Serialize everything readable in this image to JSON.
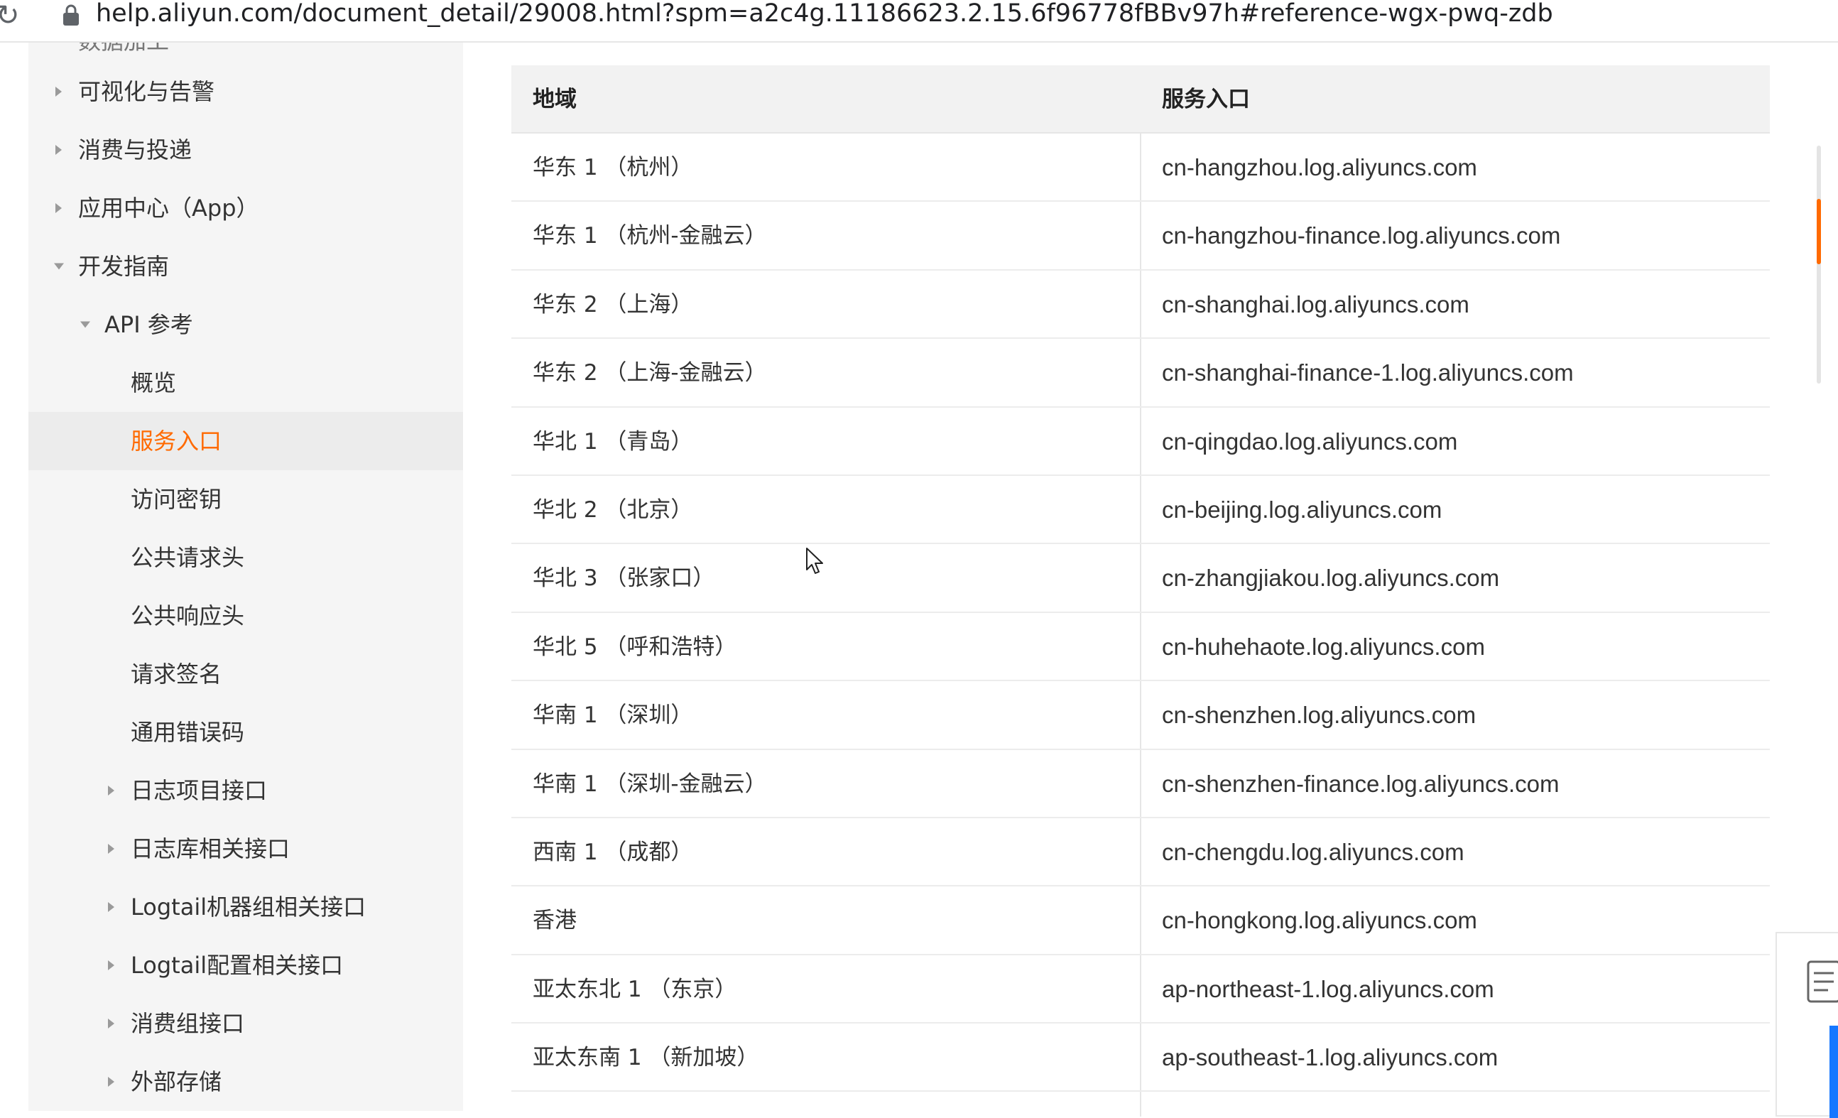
{
  "browser": {
    "url": "help.aliyun.com/document_detail/29008.html?spm=a2c4g.11186623.2.15.6f96778fBBv97h#reference-wgx-pwq-zdb"
  },
  "sidebar": {
    "cut_item": "数据加工",
    "items": [
      {
        "label": "可视化与告警",
        "arrow": "right"
      },
      {
        "label": "消费与投递",
        "arrow": "right"
      },
      {
        "label": "应用中心（App）",
        "arrow": "right"
      },
      {
        "label": "开发指南",
        "arrow": "down"
      },
      {
        "label": "API 参考",
        "arrow": "down"
      },
      {
        "label": "概览",
        "arrow": "none"
      },
      {
        "label": "服务入口",
        "arrow": "none",
        "active": true
      },
      {
        "label": "访问密钥",
        "arrow": "none"
      },
      {
        "label": "公共请求头",
        "arrow": "none"
      },
      {
        "label": "公共响应头",
        "arrow": "none"
      },
      {
        "label": "请求签名",
        "arrow": "none"
      },
      {
        "label": "通用错误码",
        "arrow": "none"
      },
      {
        "label": "日志项目接口",
        "arrow": "right"
      },
      {
        "label": "日志库相关接口",
        "arrow": "right"
      },
      {
        "label": "Logtail机器组相关接口",
        "arrow": "right"
      },
      {
        "label": "Logtail配置相关接口",
        "arrow": "right"
      },
      {
        "label": "消费组接口",
        "arrow": "right"
      },
      {
        "label": "外部存储",
        "arrow": "right"
      }
    ]
  },
  "table": {
    "headers": [
      "地域",
      "服务入口"
    ],
    "rows": [
      [
        "华东 1 （杭州）",
        "cn-hangzhou.log.aliyuncs.com"
      ],
      [
        "华东 1 （杭州-金融云）",
        "cn-hangzhou-finance.log.aliyuncs.com"
      ],
      [
        "华东 2 （上海）",
        "cn-shanghai.log.aliyuncs.com"
      ],
      [
        "华东 2 （上海-金融云）",
        "cn-shanghai-finance-1.log.aliyuncs.com"
      ],
      [
        "华北 1 （青岛）",
        "cn-qingdao.log.aliyuncs.com"
      ],
      [
        "华北 2 （北京）",
        "cn-beijing.log.aliyuncs.com"
      ],
      [
        "华北 3 （张家口）",
        "cn-zhangjiakou.log.aliyuncs.com"
      ],
      [
        "华北 5 （呼和浩特）",
        "cn-huhehaote.log.aliyuncs.com"
      ],
      [
        "华南 1 （深圳）",
        "cn-shenzhen.log.aliyuncs.com"
      ],
      [
        "华南 1 （深圳-金融云）",
        "cn-shenzhen-finance.log.aliyuncs.com"
      ],
      [
        "西南 1 （成都）",
        "cn-chengdu.log.aliyuncs.com"
      ],
      [
        "香港",
        "cn-hongkong.log.aliyuncs.com"
      ],
      [
        "亚太东北 1 （东京）",
        "ap-northeast-1.log.aliyuncs.com"
      ],
      [
        "亚太东南 1 （新加坡）",
        "ap-southeast-1.log.aliyuncs.com"
      ]
    ]
  },
  "colors": {
    "accent": "#ff6a00",
    "sidebar_bg": "#f5f5f5",
    "header_bg": "#f2f2f2",
    "widget_blue": "#1677ff"
  },
  "icons": {
    "reload": "reload-icon",
    "lock": "lock-icon",
    "cursor": "mouse-pointer-icon",
    "document": "document-icon"
  }
}
